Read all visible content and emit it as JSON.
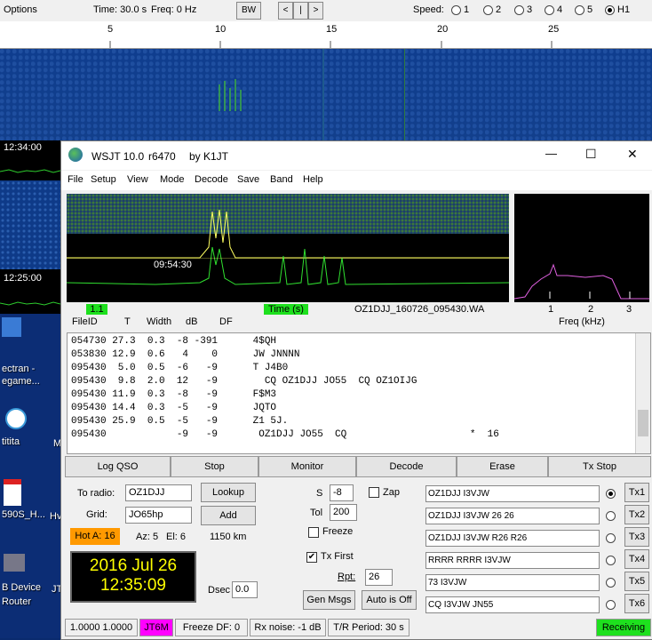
{
  "spectran": {
    "options": "Options",
    "time": "Time: 30.0 s",
    "freq": "Freq: 0 Hz",
    "bw": "BW",
    "nav": [
      "<",
      "|",
      ">"
    ],
    "speed_label": "Speed:",
    "speeds": [
      "1",
      "2",
      "3",
      "4",
      "5",
      "H1"
    ],
    "speed_selected": "H1",
    "scale": [
      "5",
      "10",
      "15",
      "20",
      "25"
    ],
    "times": [
      "12:34:00",
      "12:25:00"
    ]
  },
  "desktop": {
    "icons": [
      "ectran -",
      "egame...",
      "titita",
      "590S_H...",
      "B Device",
      "Router"
    ],
    "side": [
      "M",
      "M",
      "Hv",
      "JT"
    ]
  },
  "wsjt": {
    "title": "WSJT 10.0",
    "revision": "r6470",
    "author": "by K1JT",
    "window_buttons": [
      "—",
      "☐",
      "✕"
    ],
    "menu": [
      "File",
      "Setup",
      "View",
      "Mode",
      "Decode",
      "Save",
      "Band",
      "Help"
    ],
    "graph_time": "09:54:30",
    "label_11": "1.1",
    "label_time": "Time (s)",
    "filename": "OZ1DJJ_160726_095430.WA",
    "freq_ticks": [
      "1",
      "2",
      "3"
    ],
    "freq_label": "Freq (kHz)",
    "columns": [
      "FileID",
      "T",
      "Width",
      "dB",
      "DF"
    ],
    "rows": [
      "054730 27.3  0.3  -8 -391      4$QH",
      "053830 12.9  0.6   4    0      JW JNNNN",
      "095430  5.0  0.5  -6   -9      T J4B0",
      "095430  9.8  2.0  12   -9        CQ OZ1DJJ JO55  CQ OZ1OIJG",
      "095430 11.9  0.3  -8   -9      F$M3",
      "095430 14.4  0.3  -5   -9      JQTO",
      "095430 25.9  0.5  -5   -9      Z1 5J.",
      "095430            -9   -9       OZ1DJJ JO55  CQ                     *  16"
    ],
    "buttons": [
      "Log QSO",
      "Stop",
      "Monitor",
      "Decode",
      "Erase",
      "Tx Stop"
    ],
    "to_radio_label": "To radio:",
    "to_radio": "OZ1DJJ",
    "lookup": "Lookup",
    "grid_label": "Grid:",
    "grid": "JO65hp",
    "add": "Add",
    "hot": "Hot A: 16",
    "az": "Az: 5",
    "el": "El: 6",
    "dist": "1150 km",
    "date": "2016 Jul 26",
    "clock": "12:35:09",
    "dsec_label": "Dsec",
    "dsec": "0.0",
    "s_label": "S",
    "s_val": "-8",
    "zap": "Zap",
    "tol_label": "Tol",
    "tol": "200",
    "freeze": "Freeze",
    "txfirst": "Tx First",
    "rpt_label": "Rpt:",
    "rpt": "26",
    "genmsgs": "Gen Msgs",
    "autooff": "Auto is Off",
    "messages": [
      "OZ1DJJ I3VJW",
      "OZ1DJJ I3VJW 26 26",
      "OZ1DJJ I3VJW R26 R26",
      "RRRR RRRR I3VJW",
      "73 I3VJW",
      "CQ I3VJW JN55"
    ],
    "tx_labels": [
      "Tx1",
      "Tx2",
      "Tx3",
      "Tx4",
      "Tx5",
      "Tx6"
    ],
    "status": {
      "freqs": "1.0000 1.0000",
      "mode": "JT6M",
      "freeze_df": "Freeze DF:  0",
      "rx_noise": "Rx noise: -1 dB",
      "tr": "T/R Period: 30 s",
      "receiving": "Receiving"
    }
  },
  "colors": {
    "accent_green": "#1ee01e",
    "mode_magenta": "#ff00ff",
    "hot_orange": "#ff9900",
    "clock_yellow": "#ffff00"
  }
}
